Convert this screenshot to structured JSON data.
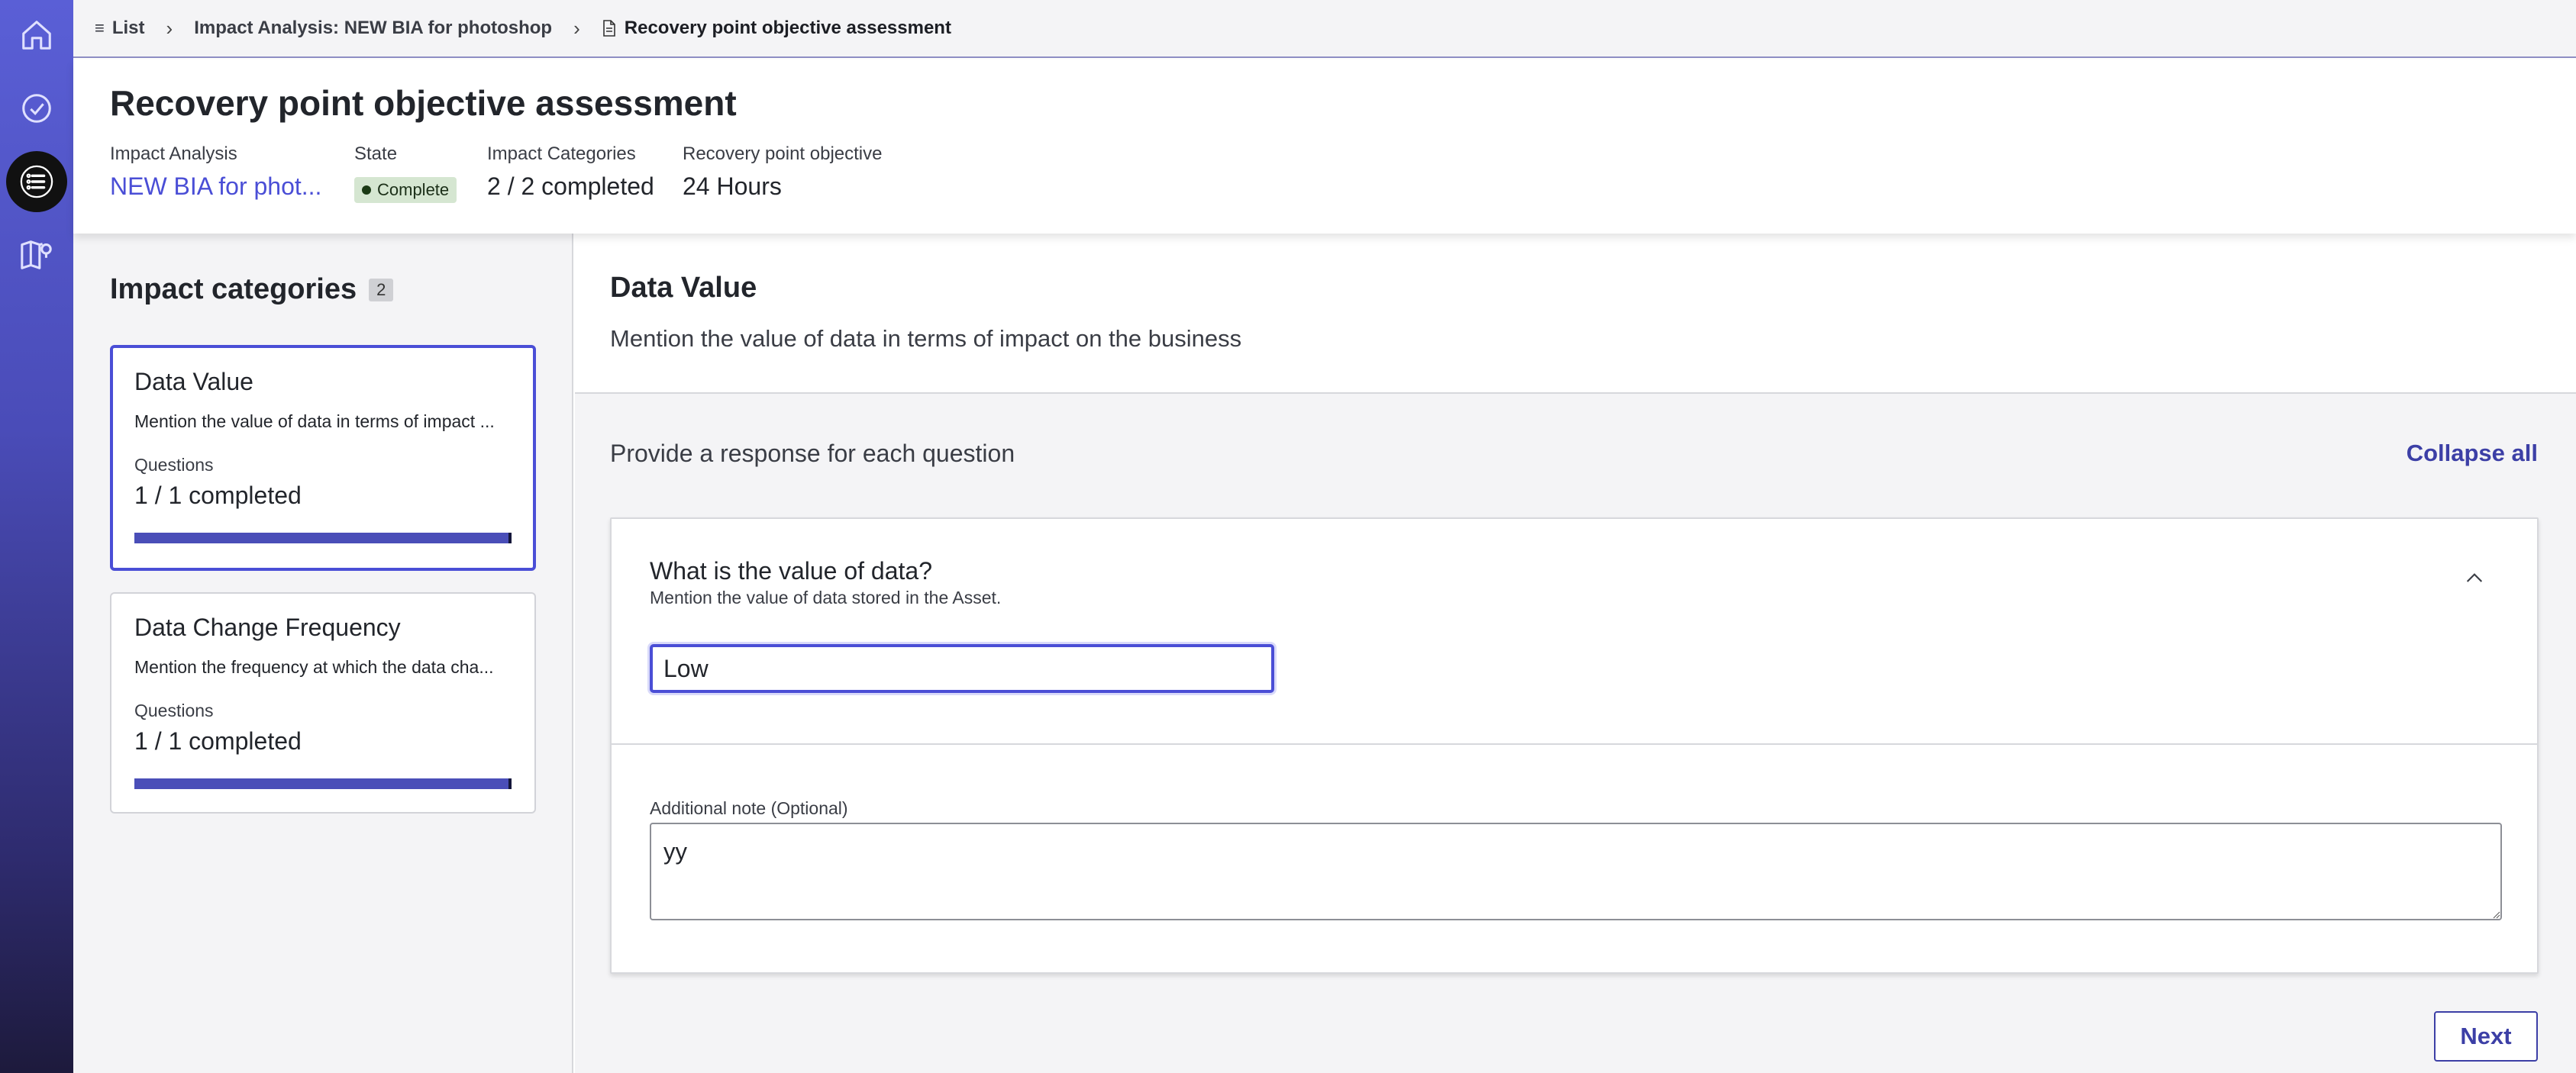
{
  "breadcrumb": {
    "items": [
      {
        "label": "List",
        "icon": "list-icon"
      },
      {
        "label": "Impact Analysis: NEW BIA for photoshop"
      },
      {
        "label": "Recovery point objective assessment",
        "icon": "document-icon"
      }
    ]
  },
  "rail": {
    "items": [
      "home-icon",
      "check-circle-icon",
      "list-icon",
      "map-icon"
    ],
    "active": "list-icon"
  },
  "header": {
    "title": "Recovery point objective assessment",
    "impact_analysis_label": "Impact Analysis",
    "impact_analysis_value": "NEW BIA for phot...",
    "state_label": "State",
    "state_value": "Complete",
    "impact_categories_label": "Impact Categories",
    "impact_categories_value": "2 / 2 completed",
    "rpo_label": "Recovery point objective",
    "rpo_value": "24 Hours"
  },
  "left_panel": {
    "title": "Impact categories",
    "count": "2",
    "cards": [
      {
        "title": "Data Value",
        "description": "Mention the value of data in terms of impact ...",
        "questions_label": "Questions",
        "questions_value": "1 / 1 completed",
        "progress": 1.0,
        "selected": true
      },
      {
        "title": "Data Change Frequency",
        "description": "Mention the frequency at which the data cha...",
        "questions_label": "Questions",
        "questions_value": "1 / 1 completed",
        "progress": 1.0,
        "selected": false
      }
    ]
  },
  "main": {
    "title": "Data Value",
    "description": "Mention the value of data in terms of impact on the business",
    "prompt": "Provide a response for each question",
    "collapse_label": "Collapse all",
    "question": {
      "title": "What is the value of data?",
      "description": "Mention the value of data stored in the Asset.",
      "answer": "Low",
      "note_label": "Additional note (Optional)",
      "note_value": "yy"
    },
    "next_label": "Next"
  },
  "colors": {
    "accent": "#4a4ed6",
    "rail_top": "#5a5fd6",
    "rail_bottom": "#1d1a3c",
    "complete_badge": "#d5e6d1"
  }
}
